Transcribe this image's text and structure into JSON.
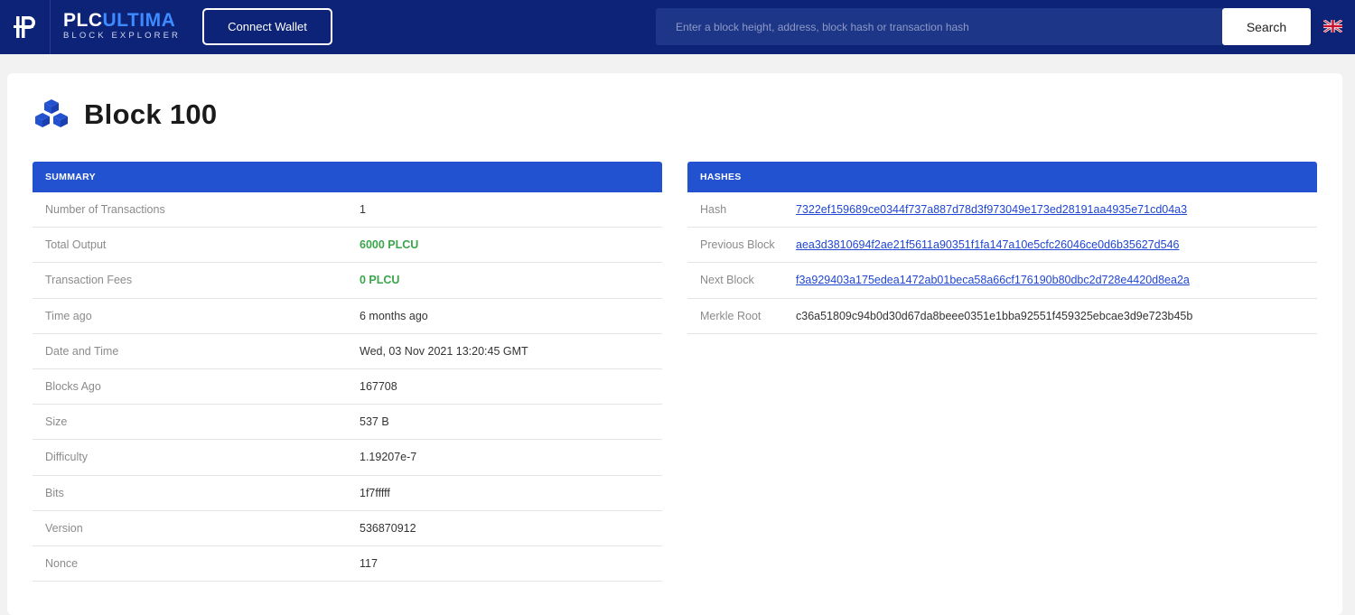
{
  "header": {
    "brand_name_prefix": "PLC",
    "brand_name_suffix": "ULTIMA",
    "brand_subtitle": "BLOCK EXPLORER",
    "connect_label": "Connect Wallet",
    "search_placeholder": "Enter a block height, address, block hash or transaction hash",
    "search_label": "Search",
    "language_icon": "uk-flag-icon"
  },
  "page": {
    "title": "Block 100",
    "title_icon": "blocks-icon"
  },
  "summary": {
    "heading": "SUMMARY",
    "rows": [
      {
        "label": "Number of Transactions",
        "value": "1"
      },
      {
        "label": "Total Output",
        "value": "6000 PLCU",
        "highlight": true
      },
      {
        "label": "Transaction Fees",
        "value": "0 PLCU",
        "highlight": true
      },
      {
        "label": "Time ago",
        "value": "6 months ago"
      },
      {
        "label": "Date and Time",
        "value": "Wed, 03 Nov 2021 13:20:45 GMT"
      },
      {
        "label": "Blocks Ago",
        "value": "167708"
      },
      {
        "label": "Size",
        "value": "537 B"
      },
      {
        "label": "Difficulty",
        "value": "1.19207e-7"
      },
      {
        "label": "Bits",
        "value": "1f7fffff"
      },
      {
        "label": "Version",
        "value": "536870912"
      },
      {
        "label": "Nonce",
        "value": "117"
      }
    ]
  },
  "hashes": {
    "heading": "HASHES",
    "rows": [
      {
        "label": "Hash",
        "value": "7322ef159689ce0344f737a887d78d3f973049e173ed28191aa4935e71cd04a3",
        "link": true
      },
      {
        "label": "Previous Block",
        "value": "aea3d3810694f2ae21f5611a90351f1fa147a10e5cfc26046ce0d6b35627d546",
        "link": true
      },
      {
        "label": "Next Block",
        "value": "f3a929403a175edea1472ab01beca58a66cf176190b80dbc2d728e4420d8ea2a",
        "link": true
      },
      {
        "label": "Merkle Root",
        "value": "c36a51809c94b0d30d67da8beee0351e1bba92551f459325ebcae3d9e723b45b",
        "link": false
      }
    ]
  },
  "colors": {
    "nav_bg": "#0d2378",
    "accent_blue": "#2352d1",
    "success_green": "#3aa54a",
    "link_blue": "#1f46d4"
  }
}
